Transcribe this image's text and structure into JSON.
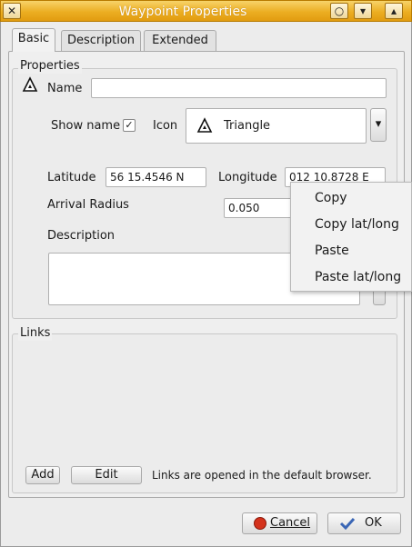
{
  "window": {
    "title": "Waypoint Properties",
    "close_glyph": "✕",
    "shade_glyph": "○",
    "menu_glyph": "▾",
    "up_glyph": "▴"
  },
  "tabs": [
    {
      "label": "Basic",
      "active": true
    },
    {
      "label": "Description",
      "active": false
    },
    {
      "label": "Extended",
      "active": false
    }
  ],
  "properties": {
    "group_label": "Properties",
    "name_label": "Name",
    "name_value": "",
    "show_name_label": "Show name",
    "show_name_checked": true,
    "check_glyph": "✓",
    "icon_label": "Icon",
    "icon_value": "Triangle",
    "latitude_label": "Latitude",
    "latitude_value": "56 15.4546 N",
    "longitude_label": "Longitude",
    "longitude_value": "012 10.8728 E",
    "arrival_radius_label": "Arrival Radius",
    "arrival_radius_value": "0.050",
    "description_label": "Description",
    "description_value": ""
  },
  "links": {
    "group_label": "Links",
    "add_label": "Add",
    "edit_label": "Edit",
    "note": "Links are opened in the default browser."
  },
  "footer": {
    "cancel_label": "Cancel",
    "ok_label": "OK"
  },
  "context_menu": {
    "items": [
      "Copy",
      "Copy lat/long",
      "Paste",
      "Paste lat/long"
    ]
  }
}
